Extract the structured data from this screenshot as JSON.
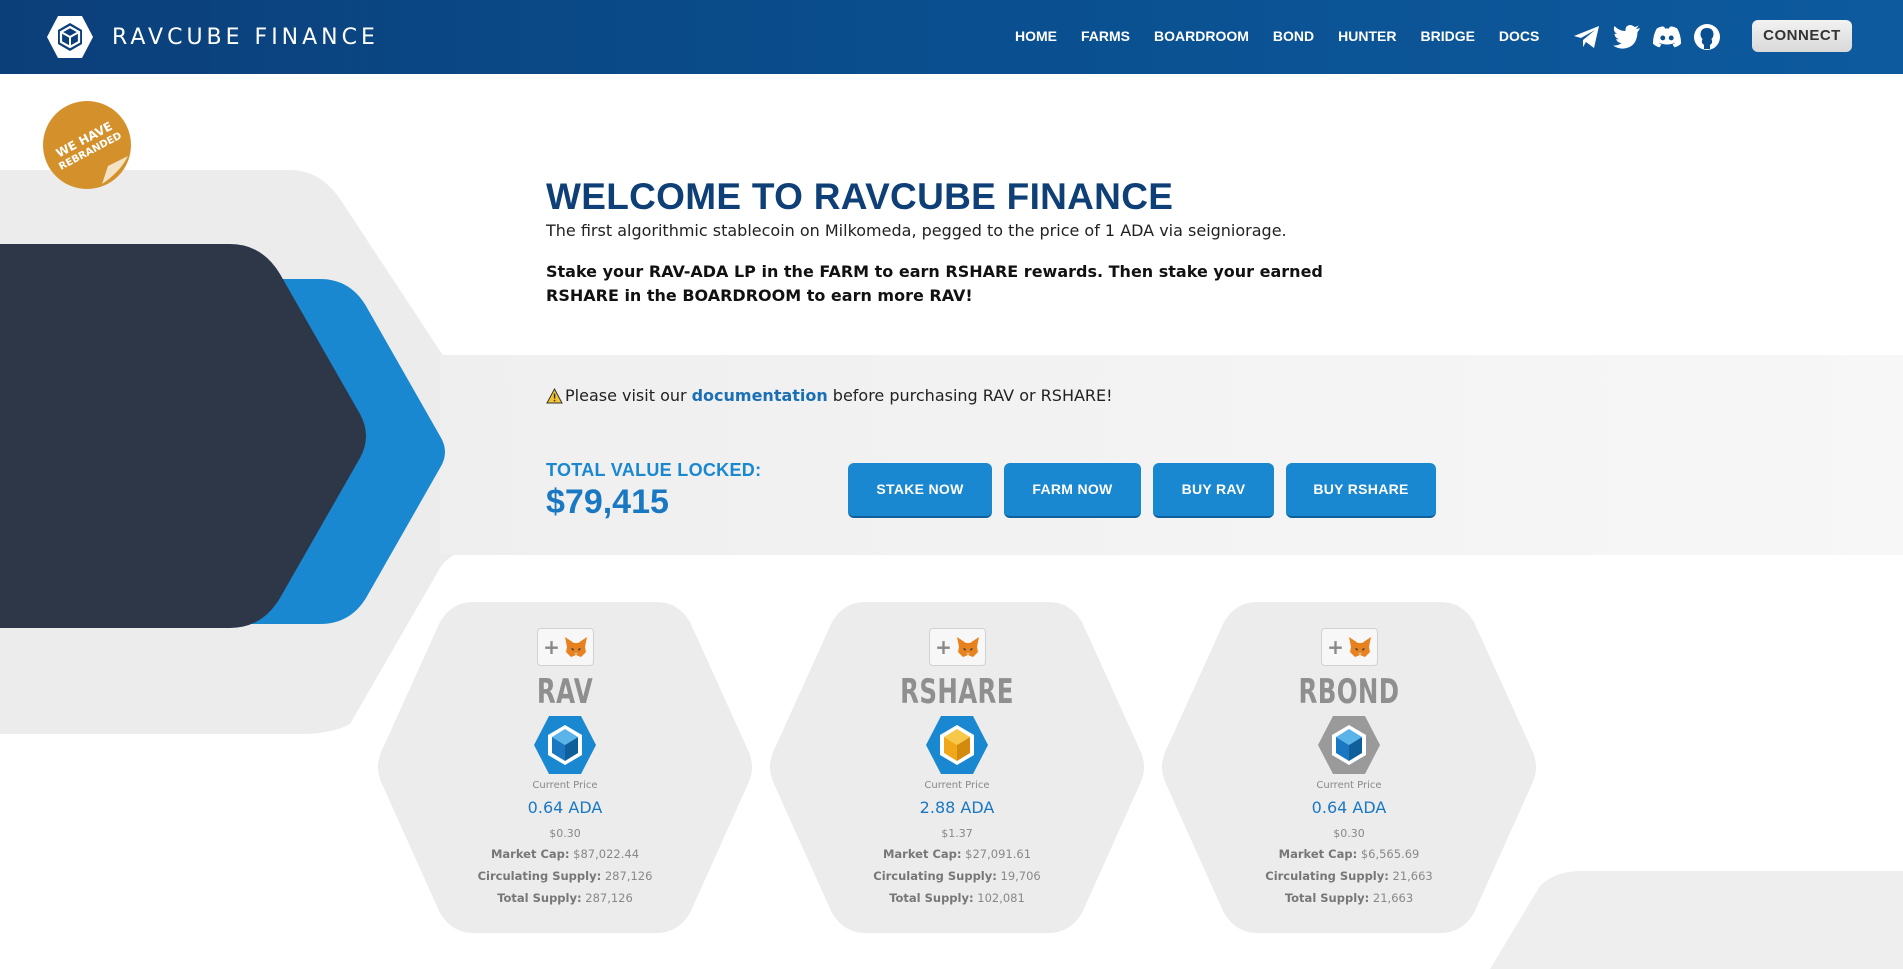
{
  "header": {
    "brand": "RAVCUBE FINANCE",
    "nav": [
      "HOME",
      "FARMS",
      "BOARDROOM",
      "BOND",
      "HUNTER",
      "BRIDGE",
      "DOCS"
    ],
    "socials": [
      "telegram-icon",
      "twitter-icon",
      "discord-icon",
      "github-icon"
    ],
    "connect_label": "CONNECT"
  },
  "sticker": {
    "line1": "WE HAVE",
    "line2": "REBRANDED"
  },
  "hero": {
    "title": "WELCOME TO RAVCUBE FINANCE",
    "subtitle": "The first algorithmic stablecoin on Milkomeda, pegged to the price of 1 ADA via seigniorage.",
    "stake_text": "Stake your RAV-ADA LP in the FARM to earn RSHARE rewards. Then stake your earned RSHARE in the BOARDROOM to earn more RAV!"
  },
  "warning": {
    "icon": "warning-icon",
    "before": "Please visit our",
    "link": "documentation",
    "after": "before purchasing RAV or RSHARE!"
  },
  "tvl": {
    "label": "TOTAL VALUE LOCKED:",
    "value": "$79,415"
  },
  "actions": {
    "stake": "STAKE NOW",
    "farm": "FARM NOW",
    "buy_rav": "BUY RAV",
    "buy_rshare": "BUY RSHARE"
  },
  "colors": {
    "header": "#0b3f7a",
    "accent": "#1a88d0",
    "dark_panel": "#2d3748",
    "sticker": "#d4902a"
  },
  "tokens": [
    {
      "name": "RAV",
      "icon_color": "#1a88d0",
      "current_price_label": "Current Price",
      "price": "0.64 ADA",
      "usd": "$0.30",
      "market_cap_label": "Market Cap:",
      "market_cap": "$87,022.44",
      "circulating_label": "Circulating Supply:",
      "circulating": "287,126",
      "total_label": "Total Supply:",
      "total": "287,126"
    },
    {
      "name": "RSHARE",
      "icon_color": "#f0a81a",
      "current_price_label": "Current Price",
      "price": "2.88 ADA",
      "usd": "$1.37",
      "market_cap_label": "Market Cap:",
      "market_cap": "$27,091.61",
      "circulating_label": "Circulating Supply:",
      "circulating": "19,706",
      "total_label": "Total Supply:",
      "total": "102,081"
    },
    {
      "name": "RBOND",
      "icon_color": "#9a9a9a",
      "current_price_label": "Current Price",
      "price": "0.64 ADA",
      "usd": "$0.30",
      "market_cap_label": "Market Cap:",
      "market_cap": "$6,565.69",
      "circulating_label": "Circulating Supply:",
      "circulating": "21,663",
      "total_label": "Total Supply:",
      "total": "21,663"
    }
  ]
}
